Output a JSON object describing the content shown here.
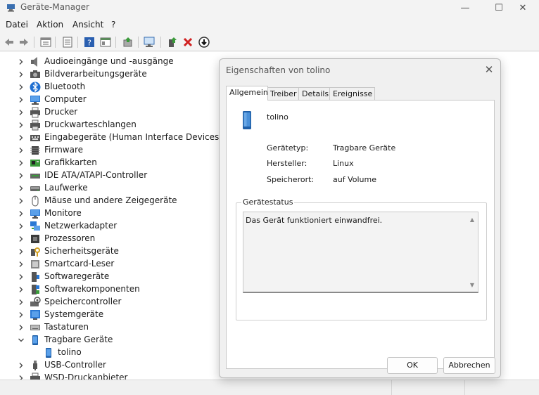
{
  "window": {
    "title": "Geräte-Manager",
    "buttons": {
      "minimize": "—",
      "maximize": "☐",
      "close": "✕"
    }
  },
  "menu": [
    "Datei",
    "Aktion",
    "Ansicht",
    "?"
  ],
  "toolbar_icons": [
    "back-arrow-icon",
    "forward-arrow-icon",
    "properties-icon",
    "list-icon",
    "help-icon",
    "view-icon",
    "update-driver-icon",
    "scan-hardware-icon",
    "enable-device-icon",
    "uninstall-icon",
    "disable-device-icon"
  ],
  "tree": {
    "items": [
      {
        "label": "Audioeingänge und -ausgänge",
        "icon": "speaker-icon",
        "expanded": false
      },
      {
        "label": "Bildverarbeitungsgeräte",
        "icon": "camera-icon",
        "expanded": false
      },
      {
        "label": "Bluetooth",
        "icon": "bluetooth-icon",
        "expanded": false
      },
      {
        "label": "Computer",
        "icon": "computer-icon",
        "expanded": false
      },
      {
        "label": "Drucker",
        "icon": "printer-icon",
        "expanded": false
      },
      {
        "label": "Druckwarteschlangen",
        "icon": "print-queue-icon",
        "expanded": false
      },
      {
        "label": "Eingabegeräte (Human Interface Devices)",
        "icon": "hid-icon",
        "expanded": false
      },
      {
        "label": "Firmware",
        "icon": "firmware-icon",
        "expanded": false
      },
      {
        "label": "Grafikkarten",
        "icon": "display-adapter-icon",
        "expanded": false
      },
      {
        "label": "IDE ATA/ATAPI-Controller",
        "icon": "ide-controller-icon",
        "expanded": false
      },
      {
        "label": "Laufwerke",
        "icon": "disk-drive-icon",
        "expanded": false
      },
      {
        "label": "Mäuse und andere Zeigegeräte",
        "icon": "mouse-icon",
        "expanded": false
      },
      {
        "label": "Monitore",
        "icon": "monitor-icon",
        "expanded": false
      },
      {
        "label": "Netzwerkadapter",
        "icon": "network-adapter-icon",
        "expanded": false
      },
      {
        "label": "Prozessoren",
        "icon": "processor-icon",
        "expanded": false
      },
      {
        "label": "Sicherheitsgeräte",
        "icon": "security-device-icon",
        "expanded": false
      },
      {
        "label": "Smartcard-Leser",
        "icon": "smartcard-reader-icon",
        "expanded": false
      },
      {
        "label": "Softwaregeräte",
        "icon": "software-device-icon",
        "expanded": false
      },
      {
        "label": "Softwarekomponenten",
        "icon": "software-component-icon",
        "expanded": false
      },
      {
        "label": "Speichercontroller",
        "icon": "storage-controller-icon",
        "expanded": false
      },
      {
        "label": "Systemgeräte",
        "icon": "system-device-icon",
        "expanded": false
      },
      {
        "label": "Tastaturen",
        "icon": "keyboard-icon",
        "expanded": false
      },
      {
        "label": "Tragbare Geräte",
        "icon": "portable-device-icon",
        "expanded": true
      },
      {
        "label": "tolino",
        "icon": "portable-device-icon",
        "child": true
      },
      {
        "label": "USB-Controller",
        "icon": "usb-icon",
        "expanded": false
      },
      {
        "label": "WSD-Druckanbieter",
        "icon": "printer-icon",
        "expanded": false
      }
    ]
  },
  "dialog": {
    "title": "Eigenschaften von tolino",
    "close": "✕",
    "tabs": [
      "Allgemein",
      "Treiber",
      "Details",
      "Ereignisse"
    ],
    "active_tab": "Allgemein",
    "device_name": "tolino",
    "properties": [
      {
        "label": "Gerätetyp:",
        "value": "Tragbare Geräte"
      },
      {
        "label": "Hersteller:",
        "value": "Linux"
      },
      {
        "label": "Speicherort:",
        "value": "auf Volume"
      }
    ],
    "status_group": "Gerätestatus",
    "status_text": "Das Gerät funktioniert einwandfrei.",
    "ok_label": "OK",
    "cancel_label": "Abbrechen"
  },
  "colors": {
    "accent": "#2a78d4",
    "tree_bg": "#ffffff",
    "window_bg": "#f3f3f3"
  }
}
